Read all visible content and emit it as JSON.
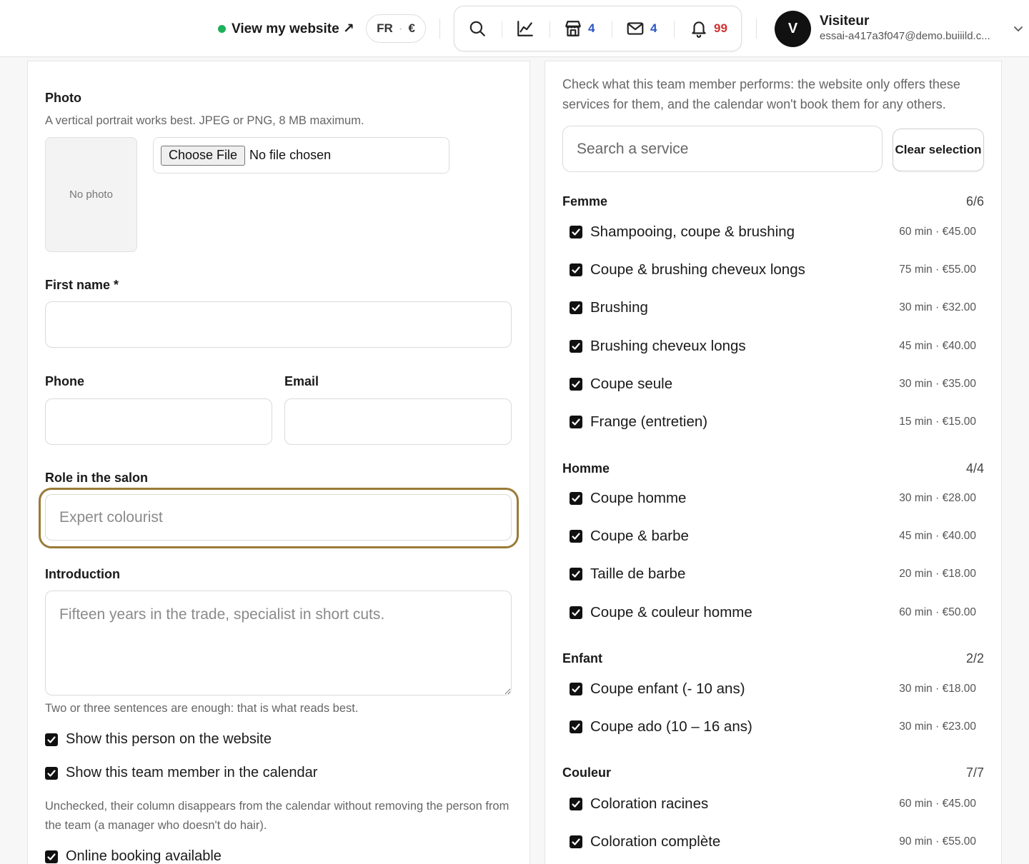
{
  "topbar": {
    "view_site_label": "View my website ↗",
    "lang": "FR",
    "lang_sep": "·",
    "currency": "€",
    "shop_count": "4",
    "mail_count": "4",
    "notif_count": "99",
    "user_initial": "V",
    "user_name": "Visiteur",
    "user_email": "essai-a417a3f047@demo.buiiild.c..."
  },
  "form": {
    "photo_label": "Photo",
    "photo_help": "A vertical portrait works best. JPEG or PNG, 8 MB maximum.",
    "no_photo": "No photo",
    "choose_file": "Choose File",
    "no_file": "No file chosen",
    "first_name_label": "First name *",
    "first_name_value": "",
    "phone_label": "Phone",
    "email_label": "Email",
    "role_label": "Role in the salon",
    "role_placeholder": "Expert colourist",
    "intro_label": "Introduction",
    "intro_placeholder": "Fifteen years in the trade, specialist in short cuts.",
    "intro_help": "Two or three sentences are enough: that is what reads best.",
    "show_website": "Show this person on the website",
    "show_calendar": "Show this team member in the calendar",
    "calendar_help": "Unchecked, their column disappears from the calendar without removing the person from the team (a manager who doesn't do hair).",
    "online_booking": "Online booking available"
  },
  "services": {
    "intro": "Check what this team member performs: the website only offers these services for them, and the calendar won't book them for any others.",
    "search_placeholder": "Search a service",
    "clear_label": "Clear selection",
    "categories": [
      {
        "name": "Femme",
        "count": "6/6",
        "items": [
          {
            "name": "Shampooing, coupe & brushing",
            "meta": "60 min · €45.00"
          },
          {
            "name": "Coupe & brushing cheveux longs",
            "meta": "75 min · €55.00"
          },
          {
            "name": "Brushing",
            "meta": "30 min · €32.00"
          },
          {
            "name": "Brushing cheveux longs",
            "meta": "45 min · €40.00"
          },
          {
            "name": "Coupe seule",
            "meta": "30 min · €35.00"
          },
          {
            "name": "Frange (entretien)",
            "meta": "15 min · €15.00"
          }
        ]
      },
      {
        "name": "Homme",
        "count": "4/4",
        "items": [
          {
            "name": "Coupe homme",
            "meta": "30 min · €28.00"
          },
          {
            "name": "Coupe & barbe",
            "meta": "45 min · €40.00"
          },
          {
            "name": "Taille de barbe",
            "meta": "20 min · €18.00"
          },
          {
            "name": "Coupe & couleur homme",
            "meta": "60 min · €50.00"
          }
        ]
      },
      {
        "name": "Enfant",
        "count": "2/2",
        "items": [
          {
            "name": "Coupe enfant (- 10 ans)",
            "meta": "30 min · €18.00"
          },
          {
            "name": "Coupe ado (10 – 16 ans)",
            "meta": "30 min · €23.00"
          }
        ]
      },
      {
        "name": "Couleur",
        "count": "7/7",
        "items": [
          {
            "name": "Coloration racines",
            "meta": "60 min · €45.00"
          },
          {
            "name": "Coloration complète",
            "meta": "90 min · €55.00"
          }
        ]
      }
    ]
  },
  "colors": {
    "accent_ring": "#9a7a37",
    "count_blue": "#2a56c6",
    "count_red": "#d43131",
    "status_green": "#1fb05a"
  }
}
